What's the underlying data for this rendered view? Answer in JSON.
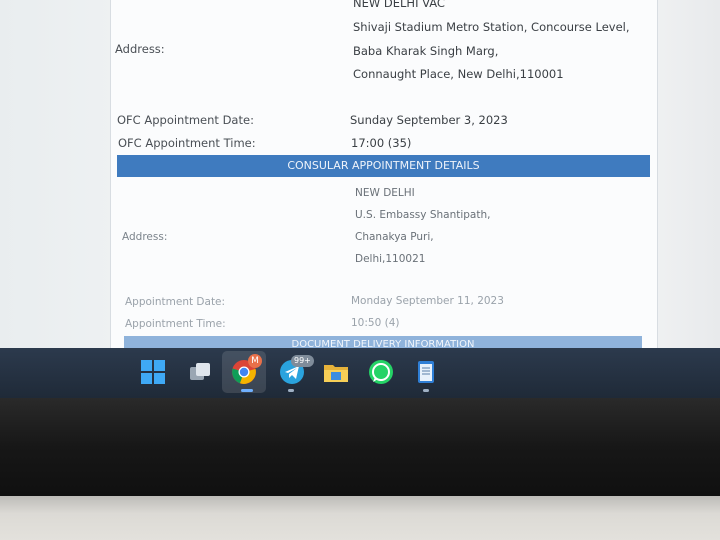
{
  "vac": {
    "name": "NEW DELHI VAC",
    "address_label": "Address:",
    "address_lines": [
      "Shivaji Stadium Metro Station, Concourse Level,",
      "Baba Kharak Singh Marg,",
      "Connaught Place, New Delhi,110001"
    ]
  },
  "ofc": {
    "date_label": "OFC Appointment Date:",
    "date_value": "Sunday September 3, 2023",
    "time_label": "OFC Appointment Time:",
    "time_value": "17:00 (35)"
  },
  "consular": {
    "header": "CONSULAR APPOINTMENT DETAILS",
    "address_label": "Address:",
    "address_lines": [
      "NEW DELHI",
      "U.S. Embassy Shantipath,",
      "Chanakya Puri,",
      "Delhi,110021"
    ],
    "date_label": "Appointment Date:",
    "date_value": "Monday September 11, 2023",
    "time_label": "Appointment Time:",
    "time_value": "10:50 (4)"
  },
  "document_header": "DOCUMENT DELIVERY INFORMATION",
  "taskbar": {
    "icons": [
      "windows-start-icon",
      "task-view-icon",
      "chrome-icon",
      "telegram-icon",
      "file-explorer-icon",
      "whatsapp-icon",
      "notepad-icon"
    ],
    "chrome_badge": "M",
    "telegram_badge": "99+"
  }
}
